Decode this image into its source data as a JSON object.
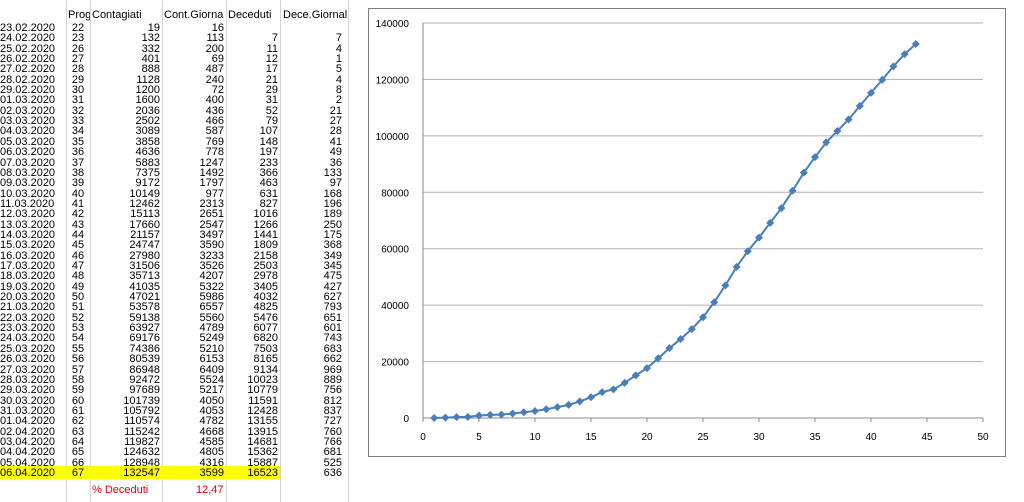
{
  "sheet": {
    "headers": {
      "date": "",
      "prog": "Prog",
      "contagiati": "Contagiati",
      "cont_giorn": "Cont.Giorna",
      "deceduti": "Deceduti",
      "dece_giorn": "Dece.Giornal."
    },
    "rows": [
      {
        "date": "23.02.2020",
        "prog": "22",
        "cont": "19",
        "cg": "16",
        "dec": "",
        "dg": ""
      },
      {
        "date": "24.02.2020",
        "prog": "23",
        "cont": "132",
        "cg": "113",
        "dec": "7",
        "dg": "7"
      },
      {
        "date": "25.02.2020",
        "prog": "26",
        "cont": "332",
        "cg": "200",
        "dec": "11",
        "dg": "4"
      },
      {
        "date": "26.02.2020",
        "prog": "27",
        "cont": "401",
        "cg": "69",
        "dec": "12",
        "dg": "1"
      },
      {
        "date": "27.02.2020",
        "prog": "28",
        "cont": "888",
        "cg": "487",
        "dec": "17",
        "dg": "5"
      },
      {
        "date": "28.02.2020",
        "prog": "29",
        "cont": "1128",
        "cg": "240",
        "dec": "21",
        "dg": "4"
      },
      {
        "date": "29.02.2020",
        "prog": "30",
        "cont": "1200",
        "cg": "72",
        "dec": "29",
        "dg": "8"
      },
      {
        "date": "01.03.2020",
        "prog": "31",
        "cont": "1600",
        "cg": "400",
        "dec": "31",
        "dg": "2"
      },
      {
        "date": "02.03.2020",
        "prog": "32",
        "cont": "2036",
        "cg": "436",
        "dec": "52",
        "dg": "21"
      },
      {
        "date": "03.03.2020",
        "prog": "33",
        "cont": "2502",
        "cg": "466",
        "dec": "79",
        "dg": "27"
      },
      {
        "date": "04.03.2020",
        "prog": "34",
        "cont": "3089",
        "cg": "587",
        "dec": "107",
        "dg": "28"
      },
      {
        "date": "05.03.2020",
        "prog": "35",
        "cont": "3858",
        "cg": "769",
        "dec": "148",
        "dg": "41"
      },
      {
        "date": "06.03.2020",
        "prog": "36",
        "cont": "4636",
        "cg": "778",
        "dec": "197",
        "dg": "49"
      },
      {
        "date": "07.03.2020",
        "prog": "37",
        "cont": "5883",
        "cg": "1247",
        "dec": "233",
        "dg": "36"
      },
      {
        "date": "08.03.2020",
        "prog": "38",
        "cont": "7375",
        "cg": "1492",
        "dec": "366",
        "dg": "133"
      },
      {
        "date": "09.03.2020",
        "prog": "39",
        "cont": "9172",
        "cg": "1797",
        "dec": "463",
        "dg": "97"
      },
      {
        "date": "10.03.2020",
        "prog": "40",
        "cont": "10149",
        "cg": "977",
        "dec": "631",
        "dg": "168"
      },
      {
        "date": "11.03.2020",
        "prog": "41",
        "cont": "12462",
        "cg": "2313",
        "dec": "827",
        "dg": "196"
      },
      {
        "date": "12.03.2020",
        "prog": "42",
        "cont": "15113",
        "cg": "2651",
        "dec": "1016",
        "dg": "189"
      },
      {
        "date": "13.03.2020",
        "prog": "43",
        "cont": "17660",
        "cg": "2547",
        "dec": "1266",
        "dg": "250"
      },
      {
        "date": "14.03.2020",
        "prog": "44",
        "cont": "21157",
        "cg": "3497",
        "dec": "1441",
        "dg": "175"
      },
      {
        "date": "15.03.2020",
        "prog": "45",
        "cont": "24747",
        "cg": "3590",
        "dec": "1809",
        "dg": "368"
      },
      {
        "date": "16.03.2020",
        "prog": "46",
        "cont": "27980",
        "cg": "3233",
        "dec": "2158",
        "dg": "349"
      },
      {
        "date": "17.03.2020",
        "prog": "47",
        "cont": "31506",
        "cg": "3526",
        "dec": "2503",
        "dg": "345"
      },
      {
        "date": "18.03.2020",
        "prog": "48",
        "cont": "35713",
        "cg": "4207",
        "dec": "2978",
        "dg": "475"
      },
      {
        "date": "19.03.2020",
        "prog": "49",
        "cont": "41035",
        "cg": "5322",
        "dec": "3405",
        "dg": "427"
      },
      {
        "date": "20.03.2020",
        "prog": "50",
        "cont": "47021",
        "cg": "5986",
        "dec": "4032",
        "dg": "627"
      },
      {
        "date": "21.03.2020",
        "prog": "51",
        "cont": "53578",
        "cg": "6557",
        "dec": "4825",
        "dg": "793"
      },
      {
        "date": "22.03.2020",
        "prog": "52",
        "cont": "59138",
        "cg": "5560",
        "dec": "5476",
        "dg": "651"
      },
      {
        "date": "23.03.2020",
        "prog": "53",
        "cont": "63927",
        "cg": "4789",
        "dec": "6077",
        "dg": "601"
      },
      {
        "date": "24.03.2020",
        "prog": "54",
        "cont": "69176",
        "cg": "5249",
        "dec": "6820",
        "dg": "743"
      },
      {
        "date": "25.03.2020",
        "prog": "55",
        "cont": "74386",
        "cg": "5210",
        "dec": "7503",
        "dg": "683"
      },
      {
        "date": "26.03.2020",
        "prog": "56",
        "cont": "80539",
        "cg": "6153",
        "dec": "8165",
        "dg": "662"
      },
      {
        "date": "27.03.2020",
        "prog": "57",
        "cont": "86948",
        "cg": "6409",
        "dec": "9134",
        "dg": "969"
      },
      {
        "date": "28.03.2020",
        "prog": "58",
        "cont": "92472",
        "cg": "5524",
        "dec": "10023",
        "dg": "889"
      },
      {
        "date": "29.03.2020",
        "prog": "59",
        "cont": "97689",
        "cg": "5217",
        "dec": "10779",
        "dg": "756"
      },
      {
        "date": "30.03.2020",
        "prog": "60",
        "cont": "101739",
        "cg": "4050",
        "dec": "11591",
        "dg": "812"
      },
      {
        "date": "31.03.2020",
        "prog": "61",
        "cont": "105792",
        "cg": "4053",
        "dec": "12428",
        "dg": "837"
      },
      {
        "date": "01.04.2020",
        "prog": "62",
        "cont": "110574",
        "cg": "4782",
        "dec": "13155",
        "dg": "727"
      },
      {
        "date": "02.04.2020",
        "prog": "63",
        "cont": "115242",
        "cg": "4668",
        "dec": "13915",
        "dg": "760"
      },
      {
        "date": "03.04.2020",
        "prog": "64",
        "cont": "119827",
        "cg": "4585",
        "dec": "14681",
        "dg": "766"
      },
      {
        "date": "04.04.2020",
        "prog": "65",
        "cont": "124632",
        "cg": "4805",
        "dec": "15362",
        "dg": "681"
      },
      {
        "date": "05.04.2020",
        "prog": "66",
        "cont": "128948",
        "cg": "4316",
        "dec": "15887",
        "dg": "525"
      },
      {
        "date": "06.04.2020",
        "prog": "67",
        "cont": "132547",
        "cg": "3599",
        "dec": "16523",
        "dg": "636"
      }
    ],
    "pct_label": "% Deceduti",
    "pct_value": "12,47",
    "highlight_color": "#ffff00"
  },
  "chart_data": {
    "type": "line",
    "xlabel": "",
    "ylabel": "",
    "xlim": [
      0,
      50
    ],
    "ylim": [
      0,
      140000
    ],
    "x_ticks": [
      "0",
      "5",
      "10",
      "15",
      "20",
      "25",
      "30",
      "35",
      "40",
      "45",
      "50"
    ],
    "y_ticks": [
      "0",
      "20000",
      "40000",
      "60000",
      "80000",
      "100000",
      "120000",
      "140000"
    ],
    "grid": "horizontal",
    "legend": "none",
    "series_color": "#4a7ebb",
    "series": [
      {
        "x": [
          1,
          2,
          3,
          4,
          5,
          6,
          7,
          8,
          9,
          10,
          11,
          12,
          13,
          14,
          15,
          16,
          17,
          18,
          19,
          20,
          21,
          22,
          23,
          24,
          25,
          26,
          27,
          28,
          29,
          30,
          31,
          32,
          33,
          34,
          35,
          36,
          37,
          38,
          39,
          40,
          41,
          42,
          43,
          44
        ],
        "y": [
          19,
          132,
          332,
          401,
          888,
          1128,
          1200,
          1600,
          2036,
          2502,
          3089,
          3858,
          4636,
          5883,
          7375,
          9172,
          10149,
          12462,
          15113,
          17660,
          21157,
          24747,
          27980,
          31506,
          35713,
          41035,
          47021,
          53578,
          59138,
          63927,
          69176,
          74386,
          80539,
          86948,
          92472,
          97689,
          101739,
          105792,
          110574,
          115242,
          119827,
          124632,
          128948,
          132547
        ]
      }
    ]
  }
}
